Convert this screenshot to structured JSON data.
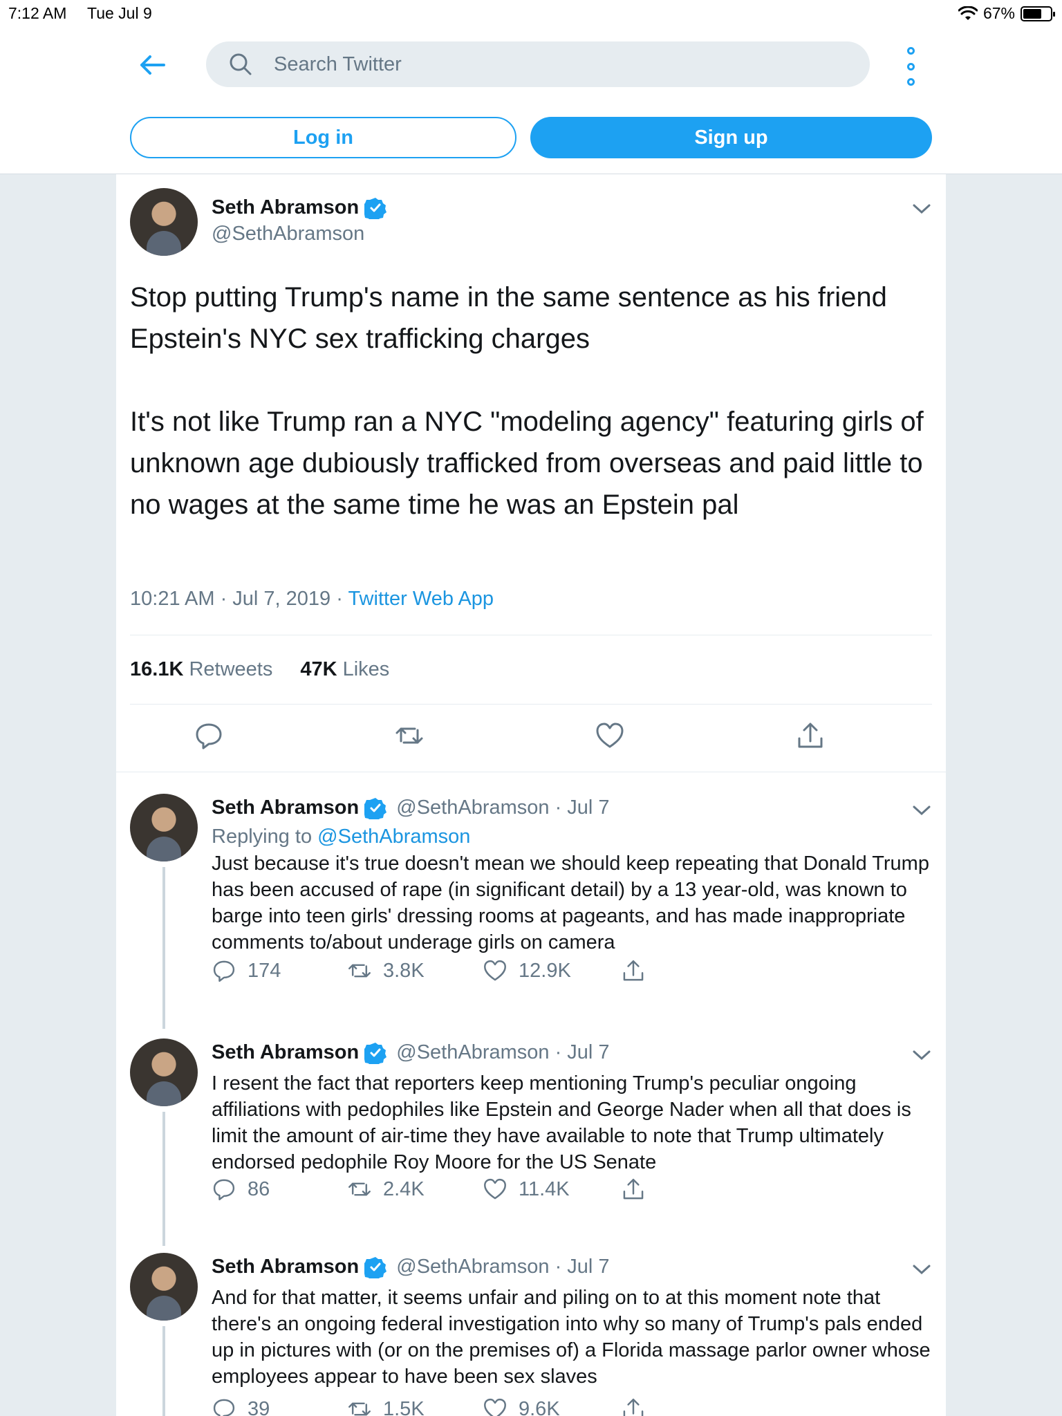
{
  "status_bar": {
    "time": "7:12 AM",
    "date": "Tue Jul 9",
    "battery": "67%"
  },
  "header": {
    "search_placeholder": "Search Twitter",
    "login_label": "Log in",
    "signup_label": "Sign up"
  },
  "main_tweet": {
    "name": "Seth Abramson",
    "handle": "@SethAbramson",
    "paragraphs": [
      "Stop putting Trump's name in the same sentence as his friend Epstein's NYC sex trafficking charges",
      "It's not like Trump ran a NYC \"modeling agency\" featuring girls of unknown age dubiously trafficked from overseas and paid little to no wages at the same time he was an Epstein pal"
    ],
    "time": "10:21 AM · Jul 7, 2019 · ",
    "source": "Twitter Web App",
    "retweets_count": "16.1K",
    "retweets_label": "Retweets",
    "likes_count": "47K",
    "likes_label": "Likes"
  },
  "replies": [
    {
      "name": "Seth Abramson",
      "handle_date": "@SethAbramson · Jul 7",
      "replying_prefix": "Replying to ",
      "replying_handle": "@SethAbramson",
      "text": "Just because it's true doesn't mean we should keep repeating that Donald Trump has been accused of rape (in significant detail) by a 13 year-old, was known to barge into teen girls' dressing rooms at pageants, and has made inappropriate comments to/about underage girls on camera",
      "replies": "174",
      "retweets": "3.8K",
      "likes": "12.9K"
    },
    {
      "name": "Seth Abramson",
      "handle_date": "@SethAbramson · Jul 7",
      "text": "I resent the fact that reporters keep mentioning Trump's peculiar ongoing affiliations with pedophiles like Epstein and George Nader when all that does is limit the amount of air-time they have available to note that Trump ultimately endorsed pedophile Roy Moore for the US Senate",
      "replies": "86",
      "retweets": "2.4K",
      "likes": "11.4K"
    },
    {
      "name": "Seth Abramson",
      "handle_date": "@SethAbramson · Jul 7",
      "text": "And for that matter, it seems unfair and piling on to at this moment note that there's an ongoing federal investigation into why so many of Trump's pals ended up in pictures with (or on the premises of) a Florida massage parlor owner whose employees appear to have been sex slaves",
      "replies": "39",
      "retweets": "1.5K",
      "likes": "9.6K"
    }
  ],
  "colors": {
    "accent": "#1da1f2",
    "link": "#1b95e0",
    "secondary_text": "#657786",
    "background": "#e6ecf0"
  },
  "icons": [
    "back-arrow-icon",
    "search-icon",
    "more-vertical-icon",
    "verified-badge-icon",
    "chevron-down-icon",
    "reply-icon",
    "retweet-icon",
    "like-icon",
    "share-icon"
  ]
}
